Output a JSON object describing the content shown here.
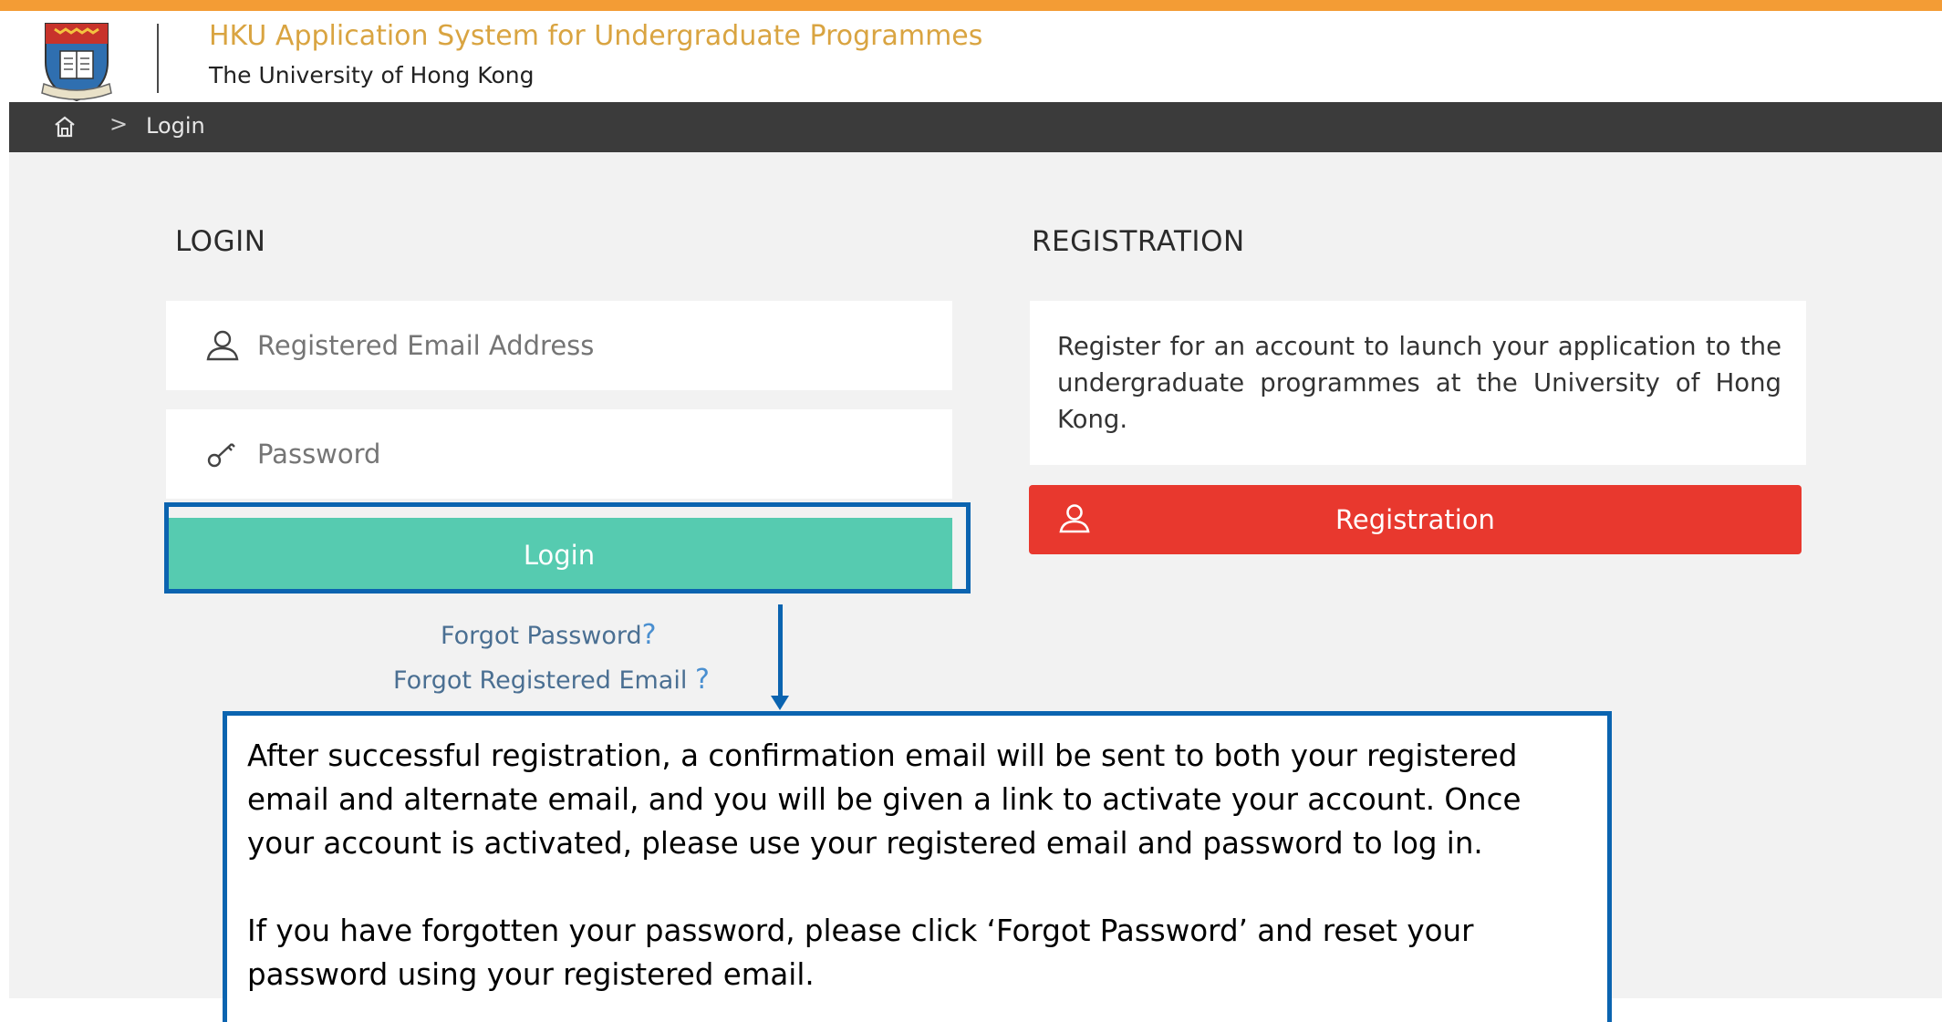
{
  "header": {
    "title": "HKU Application System for Undergraduate Programmes",
    "subtitle": "The University of Hong Kong",
    "crest_icon": "university-crest-icon"
  },
  "breadcrumb": {
    "home_icon": "home-icon",
    "separator": ">",
    "current": "Login"
  },
  "login": {
    "heading": "LOGIN",
    "email_placeholder": "Registered Email Address",
    "email_value": "",
    "password_placeholder": "Password",
    "password_value": "",
    "button_label": "Login",
    "forgot_password": "Forgot Password",
    "forgot_email": "Forgot Registered Email",
    "question_mark": "?"
  },
  "registration": {
    "heading": "REGISTRATION",
    "description": "Register for an account to launch your application to the undergraduate programmes at the University of Hong Kong.",
    "button_label": "Registration"
  },
  "callout": {
    "paragraph1": "After successful registration, a confirmation email will be sent to both your registered email and alternate email, and you will be given a link to activate your account. Once your account is activated, please use your registered email and password to log in.",
    "paragraph2": "If you have forgotten your password, please click ‘Forgot Password’ and reset your password using your registered email."
  },
  "colors": {
    "accent_orange": "#f39c35",
    "title_gold": "#d9a441",
    "navbar": "#3b3b3b",
    "login_button": "#56cbb0",
    "registration_button": "#e8382e",
    "annotation_blue": "#0b64b0",
    "link": "#4a6f92"
  }
}
